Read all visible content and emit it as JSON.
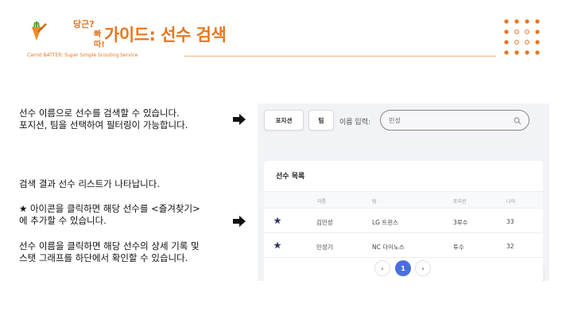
{
  "header": {
    "logo_line1": "당근?",
    "logo_line2": "빠따!",
    "title": "가이드: 선수 검색",
    "subtitle": "Carrot BATTER: Super Simple Scouting Service"
  },
  "descriptions": [
    "선수 이름으로 선수를 검색할 수 있습니다.\n포지션, 팀을 선택하여 필터링이 가능합니다.",
    "검색 결과 선수 리스트가 나타납니다.",
    "★ 아이콘을 클릭하면 해당 선수를 <즐겨찾기>\n에 추가할 수 있습니다.",
    "선수 이름을 클릭하면 해당 선수의 상세 기록 및\n스탯 그래프를 하단에서 확인할 수 있습니다."
  ],
  "filters": {
    "position_label": "포지션",
    "team_label": "팀",
    "search_label": "이름 입력:",
    "search_value": "민성"
  },
  "list": {
    "title": "선수 목록",
    "columns": [
      "이름",
      "팀",
      "포지션",
      "나이"
    ],
    "rows": [
      {
        "name": "김민성",
        "team": "LG 트윈스",
        "position": "3루수",
        "age": "33"
      },
      {
        "name": "민성기",
        "team": "NC 다이노스",
        "position": "투수",
        "age": "32"
      }
    ]
  },
  "pagination": {
    "prev": "‹",
    "current": "1",
    "next": "›"
  },
  "colors": {
    "brand": "#e8761f",
    "active_page": "#4a6ee0",
    "star": "#2d3a63"
  }
}
